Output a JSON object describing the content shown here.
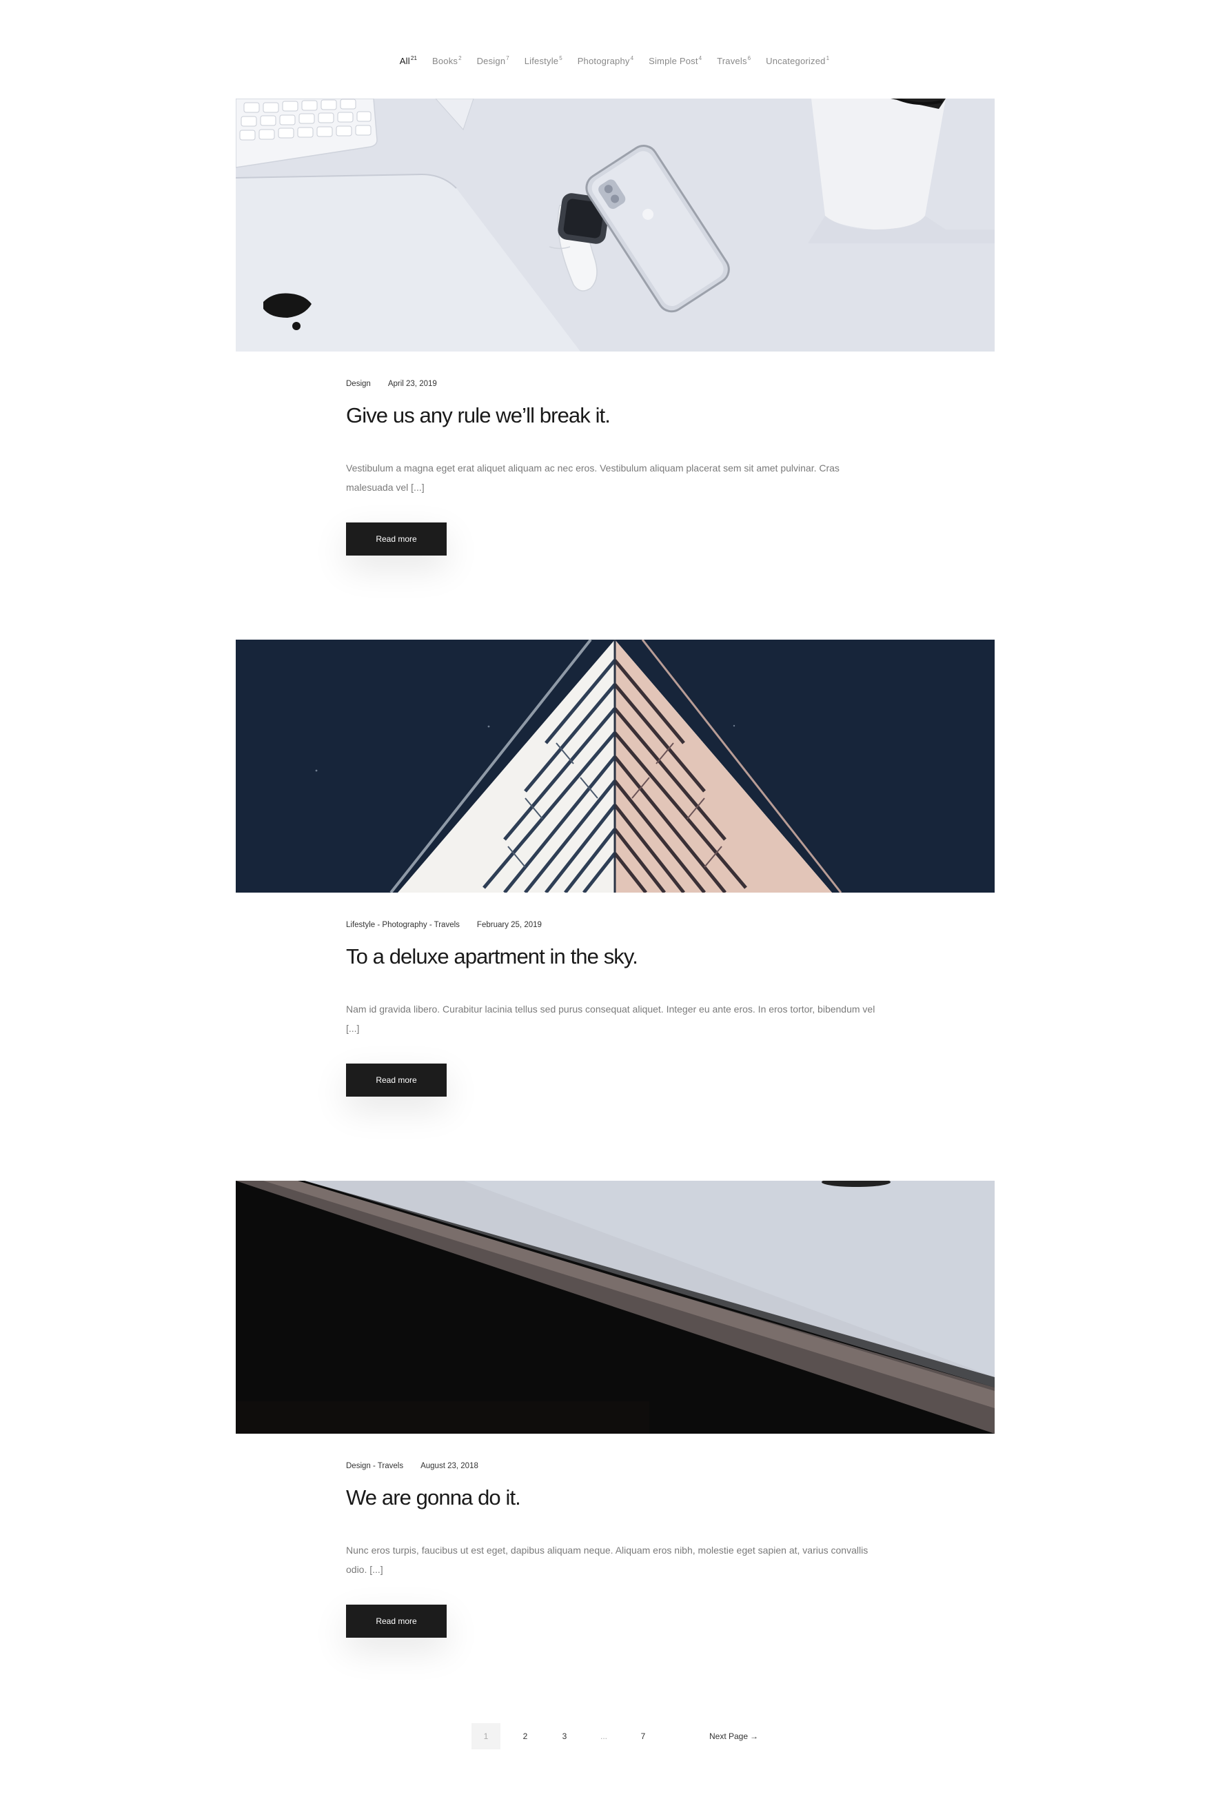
{
  "filters": [
    {
      "label": "All",
      "count": "21"
    },
    {
      "label": "Books",
      "count": "2"
    },
    {
      "label": "Design",
      "count": "7"
    },
    {
      "label": "Lifestyle",
      "count": "5"
    },
    {
      "label": "Photography",
      "count": "4"
    },
    {
      "label": "Simple Post",
      "count": "4"
    },
    {
      "label": "Travels",
      "count": "6"
    },
    {
      "label": "Uncategorized",
      "count": "1"
    }
  ],
  "posts": [
    {
      "categories": "Design",
      "date": "April 23, 2019",
      "title": "Give us any rule we’ll break it.",
      "excerpt": "Vestibulum a magna eget erat aliquet aliquam ac nec eros. Vestibulum aliquam placerat sem sit amet pulvinar. Cras malesuada vel [...]",
      "read_more": "Read more"
    },
    {
      "categories": "Lifestyle - Photography - Travels",
      "date": "February 25, 2019",
      "title": "To a deluxe apartment in the sky.",
      "excerpt": "Nam id gravida libero. Curabitur lacinia tellus sed purus consequat aliquet. Integer eu ante eros. In eros tortor, bibendum vel [...]",
      "read_more": "Read more"
    },
    {
      "categories": "Design - Travels",
      "date": "August 23, 2018",
      "title": "We are gonna do it.",
      "excerpt": "Nunc eros turpis, faucibus ut est eget, dapibus aliquam neque. Aliquam eros nibh, molestie eget sapien at, varius convallis odio. [...]",
      "read_more": "Read more"
    }
  ],
  "pagination": {
    "pages": [
      "1",
      "2",
      "3",
      "...",
      "7"
    ],
    "current": "1",
    "next_label": "Next Page",
    "next_arrow": "→"
  }
}
